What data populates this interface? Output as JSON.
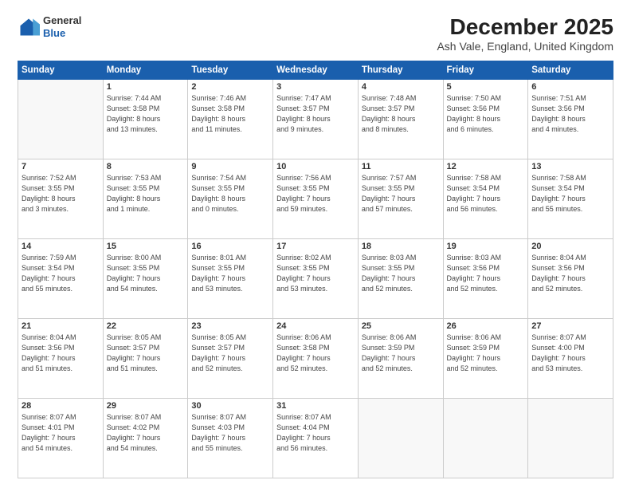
{
  "logo": {
    "line1": "General",
    "line2": "Blue"
  },
  "title": "December 2025",
  "subtitle": "Ash Vale, England, United Kingdom",
  "headers": [
    "Sunday",
    "Monday",
    "Tuesday",
    "Wednesday",
    "Thursday",
    "Friday",
    "Saturday"
  ],
  "weeks": [
    [
      {
        "day": "",
        "info": ""
      },
      {
        "day": "1",
        "info": "Sunrise: 7:44 AM\nSunset: 3:58 PM\nDaylight: 8 hours\nand 13 minutes."
      },
      {
        "day": "2",
        "info": "Sunrise: 7:46 AM\nSunset: 3:58 PM\nDaylight: 8 hours\nand 11 minutes."
      },
      {
        "day": "3",
        "info": "Sunrise: 7:47 AM\nSunset: 3:57 PM\nDaylight: 8 hours\nand 9 minutes."
      },
      {
        "day": "4",
        "info": "Sunrise: 7:48 AM\nSunset: 3:57 PM\nDaylight: 8 hours\nand 8 minutes."
      },
      {
        "day": "5",
        "info": "Sunrise: 7:50 AM\nSunset: 3:56 PM\nDaylight: 8 hours\nand 6 minutes."
      },
      {
        "day": "6",
        "info": "Sunrise: 7:51 AM\nSunset: 3:56 PM\nDaylight: 8 hours\nand 4 minutes."
      }
    ],
    [
      {
        "day": "7",
        "info": "Sunrise: 7:52 AM\nSunset: 3:55 PM\nDaylight: 8 hours\nand 3 minutes."
      },
      {
        "day": "8",
        "info": "Sunrise: 7:53 AM\nSunset: 3:55 PM\nDaylight: 8 hours\nand 1 minute."
      },
      {
        "day": "9",
        "info": "Sunrise: 7:54 AM\nSunset: 3:55 PM\nDaylight: 8 hours\nand 0 minutes."
      },
      {
        "day": "10",
        "info": "Sunrise: 7:56 AM\nSunset: 3:55 PM\nDaylight: 7 hours\nand 59 minutes."
      },
      {
        "day": "11",
        "info": "Sunrise: 7:57 AM\nSunset: 3:55 PM\nDaylight: 7 hours\nand 57 minutes."
      },
      {
        "day": "12",
        "info": "Sunrise: 7:58 AM\nSunset: 3:54 PM\nDaylight: 7 hours\nand 56 minutes."
      },
      {
        "day": "13",
        "info": "Sunrise: 7:58 AM\nSunset: 3:54 PM\nDaylight: 7 hours\nand 55 minutes."
      }
    ],
    [
      {
        "day": "14",
        "info": "Sunrise: 7:59 AM\nSunset: 3:54 PM\nDaylight: 7 hours\nand 55 minutes."
      },
      {
        "day": "15",
        "info": "Sunrise: 8:00 AM\nSunset: 3:55 PM\nDaylight: 7 hours\nand 54 minutes."
      },
      {
        "day": "16",
        "info": "Sunrise: 8:01 AM\nSunset: 3:55 PM\nDaylight: 7 hours\nand 53 minutes."
      },
      {
        "day": "17",
        "info": "Sunrise: 8:02 AM\nSunset: 3:55 PM\nDaylight: 7 hours\nand 53 minutes."
      },
      {
        "day": "18",
        "info": "Sunrise: 8:03 AM\nSunset: 3:55 PM\nDaylight: 7 hours\nand 52 minutes."
      },
      {
        "day": "19",
        "info": "Sunrise: 8:03 AM\nSunset: 3:56 PM\nDaylight: 7 hours\nand 52 minutes."
      },
      {
        "day": "20",
        "info": "Sunrise: 8:04 AM\nSunset: 3:56 PM\nDaylight: 7 hours\nand 52 minutes."
      }
    ],
    [
      {
        "day": "21",
        "info": "Sunrise: 8:04 AM\nSunset: 3:56 PM\nDaylight: 7 hours\nand 51 minutes."
      },
      {
        "day": "22",
        "info": "Sunrise: 8:05 AM\nSunset: 3:57 PM\nDaylight: 7 hours\nand 51 minutes."
      },
      {
        "day": "23",
        "info": "Sunrise: 8:05 AM\nSunset: 3:57 PM\nDaylight: 7 hours\nand 52 minutes."
      },
      {
        "day": "24",
        "info": "Sunrise: 8:06 AM\nSunset: 3:58 PM\nDaylight: 7 hours\nand 52 minutes."
      },
      {
        "day": "25",
        "info": "Sunrise: 8:06 AM\nSunset: 3:59 PM\nDaylight: 7 hours\nand 52 minutes."
      },
      {
        "day": "26",
        "info": "Sunrise: 8:06 AM\nSunset: 3:59 PM\nDaylight: 7 hours\nand 52 minutes."
      },
      {
        "day": "27",
        "info": "Sunrise: 8:07 AM\nSunset: 4:00 PM\nDaylight: 7 hours\nand 53 minutes."
      }
    ],
    [
      {
        "day": "28",
        "info": "Sunrise: 8:07 AM\nSunset: 4:01 PM\nDaylight: 7 hours\nand 54 minutes."
      },
      {
        "day": "29",
        "info": "Sunrise: 8:07 AM\nSunset: 4:02 PM\nDaylight: 7 hours\nand 54 minutes."
      },
      {
        "day": "30",
        "info": "Sunrise: 8:07 AM\nSunset: 4:03 PM\nDaylight: 7 hours\nand 55 minutes."
      },
      {
        "day": "31",
        "info": "Sunrise: 8:07 AM\nSunset: 4:04 PM\nDaylight: 7 hours\nand 56 minutes."
      },
      {
        "day": "",
        "info": ""
      },
      {
        "day": "",
        "info": ""
      },
      {
        "day": "",
        "info": ""
      }
    ]
  ]
}
